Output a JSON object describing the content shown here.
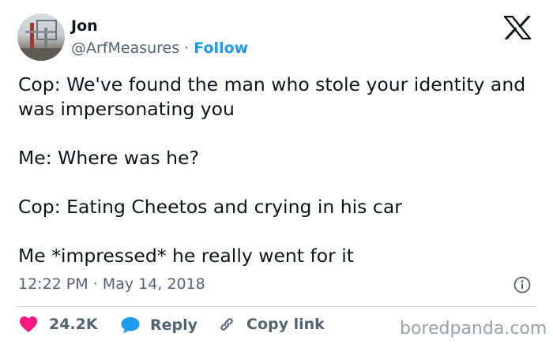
{
  "author": {
    "display_name": "Jon",
    "handle": "@ArfMeasures",
    "separator": "·",
    "follow_label": "Follow"
  },
  "tweet": {
    "paragraphs": [
      "Cop: We've found the man who stole your identity and was impersonating you",
      "Me: Where was he?",
      "Cop: Eating Cheetos and crying in his car",
      "Me *impressed* he really went for it"
    ]
  },
  "meta": {
    "time": "12:22 PM",
    "separator": "·",
    "date": "May 14, 2018"
  },
  "actions": {
    "like_count": "24.2K",
    "reply_label": "Reply",
    "copy_link_label": "Copy link"
  },
  "watermark": "boredpanda.com",
  "icons": {
    "platform": "x-logo-icon",
    "info": "info-icon",
    "like": "heart-icon",
    "reply": "speech-bubble-icon",
    "copy": "link-icon"
  },
  "colors": {
    "accent": "#1d9bf0",
    "like": "#f91880",
    "secondary_text": "#536471",
    "divider": "#cfd9de"
  }
}
